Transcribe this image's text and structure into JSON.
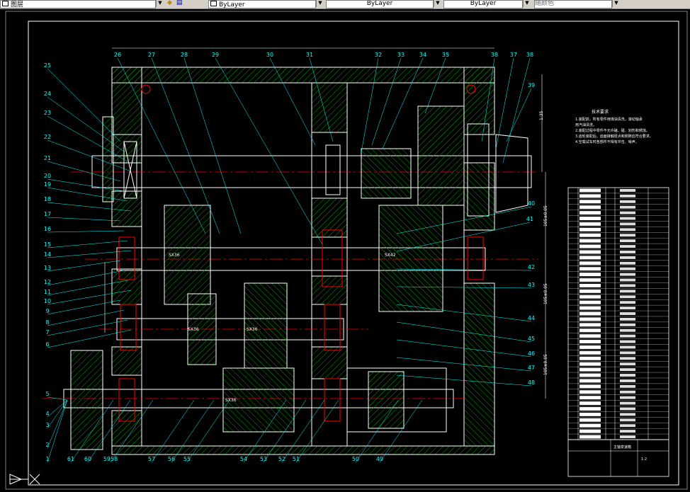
{
  "toolbar": {
    "layer_name": "图层",
    "color": "ByLayer",
    "linetype": "ByLayer",
    "lineweight": "ByLayer",
    "plot_style": "随颜色"
  },
  "balloons_top": [
    "26",
    "27",
    "28",
    "29",
    "30",
    "31",
    "32",
    "33",
    "34",
    "35",
    "38",
    "37",
    "38",
    "39"
  ],
  "balloons_left": [
    "25",
    "24",
    "23",
    "22",
    "21",
    "20",
    "19",
    "18",
    "17",
    "16",
    "15",
    "14",
    "13",
    "12",
    "11",
    "10",
    "9",
    "8",
    "7",
    "6",
    "5",
    "4",
    "3",
    "2",
    "1"
  ],
  "balloons_bottom": [
    "61",
    "60",
    "5958",
    "57",
    "56",
    "55",
    "54",
    "53",
    "52",
    "51",
    "50",
    "49"
  ],
  "balloons_right": [
    "40",
    "41",
    "42",
    "43",
    "44",
    "45",
    "46",
    "47",
    "48"
  ],
  "shaft_labels": [
    "SX36",
    "SX42",
    "SX36",
    "SX36",
    "SX36"
  ],
  "dim_labels": [
    "1:35",
    "105±0.05",
    "105±0.05",
    "105±0.05"
  ],
  "notes": {
    "title": "技术要求",
    "lines": [
      "1.装配前，所有零件用煤油清洗，滚动轴承",
      "用汽油清洗。",
      "2.装配过程中零件不允许磕、碰、划伤和锈蚀。",
      "3.齿轮装配后，齿面接触斑点和侧隙应符合要求。",
      "4.空载试车时各部件不得有冲击、噪声。"
    ]
  },
  "bom_rows": 45,
  "title_block": {
    "name": "主轴变速箱",
    "scale": "1:2"
  }
}
